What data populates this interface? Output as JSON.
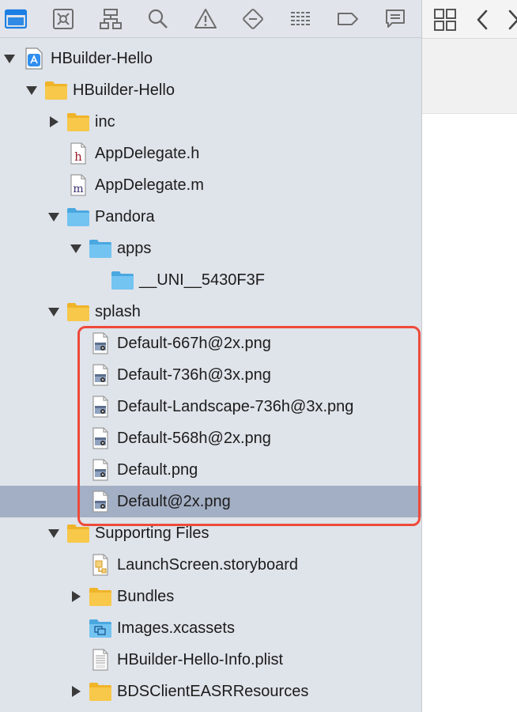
{
  "toolbar": {
    "icons": [
      "folder-icon",
      "source-control-icon",
      "hierarchy-icon",
      "search-icon",
      "warning-icon",
      "test-icon",
      "debug-icon",
      "breakpoint-icon",
      "report-icon"
    ]
  },
  "right_toolbar": {
    "icons": [
      "related-items-icon",
      "back-arrow-icon",
      "forward-arrow-icon"
    ]
  },
  "tree": [
    {
      "label": "HBuilder-Hello",
      "icon": "project-icon",
      "expanded": true
    },
    {
      "label": "HBuilder-Hello",
      "icon": "folder-icon",
      "expanded": true
    },
    {
      "label": "inc",
      "icon": "folder-icon",
      "expanded": false
    },
    {
      "label": "AppDelegate.h",
      "icon": "header-file-icon"
    },
    {
      "label": "AppDelegate.m",
      "icon": "implementation-file-icon"
    },
    {
      "label": "Pandora",
      "icon": "blue-folder-icon",
      "expanded": true
    },
    {
      "label": "apps",
      "icon": "blue-folder-icon",
      "expanded": true
    },
    {
      "label": "__UNI__5430F3F",
      "icon": "blue-folder-icon"
    },
    {
      "label": "splash",
      "icon": "folder-icon",
      "expanded": true
    },
    {
      "label": "Default-667h@2x.png",
      "icon": "png-file-icon"
    },
    {
      "label": "Default-736h@3x.png",
      "icon": "png-file-icon"
    },
    {
      "label": "Default-Landscape-736h@3x.png",
      "icon": "png-file-icon"
    },
    {
      "label": "Default-568h@2x.png",
      "icon": "png-file-icon"
    },
    {
      "label": "Default.png",
      "icon": "png-file-icon"
    },
    {
      "label": "Default@2x.png",
      "icon": "png-file-icon",
      "selected": true
    },
    {
      "label": "Supporting Files",
      "icon": "folder-icon",
      "expanded": true
    },
    {
      "label": "LaunchScreen.storyboard",
      "icon": "storyboard-file-icon"
    },
    {
      "label": "Bundles",
      "icon": "folder-icon",
      "expanded": false
    },
    {
      "label": "Images.xcassets",
      "icon": "asset-catalog-icon"
    },
    {
      "label": "HBuilder-Hello-Info.plist",
      "icon": "plist-file-icon"
    },
    {
      "label": "BDSClientEASRResources",
      "icon": "folder-icon",
      "expanded": false
    }
  ],
  "colors": {
    "sidebar_bg": "#dfe3ea",
    "selection": "#a3afc4",
    "highlight_border": "#ee4a3a",
    "folder_yellow": "#f7c23b",
    "folder_blue": "#6cc1ef",
    "toolbar_active": "#1b7fe3"
  }
}
